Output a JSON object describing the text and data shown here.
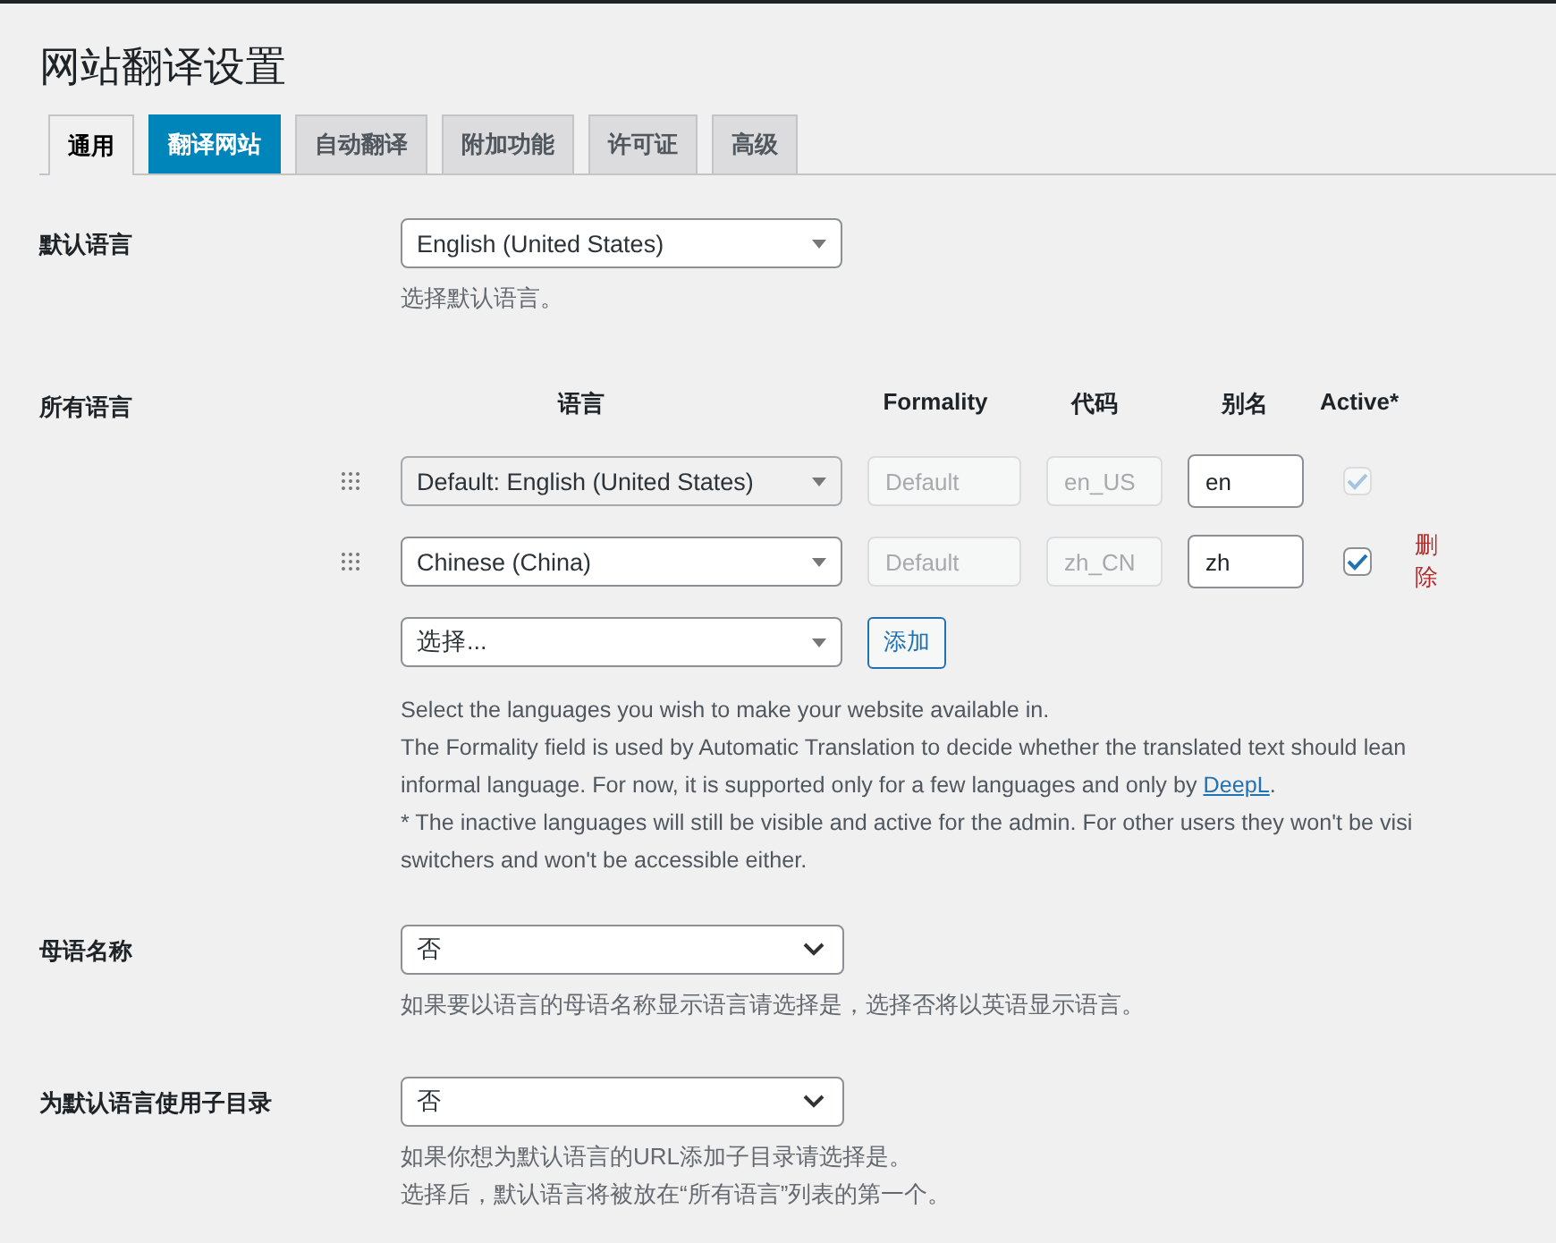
{
  "page_title": "网站翻译设置",
  "tabs": [
    {
      "label": "通用",
      "selected": true,
      "highlighted": false
    },
    {
      "label": "翻译网站",
      "selected": false,
      "highlighted": true
    },
    {
      "label": "自动翻译",
      "selected": false,
      "highlighted": false
    },
    {
      "label": "附加功能",
      "selected": false,
      "highlighted": false
    },
    {
      "label": "许可证",
      "selected": false,
      "highlighted": false
    },
    {
      "label": "高级",
      "selected": false,
      "highlighted": false
    }
  ],
  "default_language": {
    "label": "默认语言",
    "value": "English (United States)",
    "hint": "选择默认语言。"
  },
  "all_languages": {
    "label": "所有语言",
    "columns": [
      "语言",
      "Formality",
      "代码",
      "别名",
      "Active*"
    ],
    "rows": [
      {
        "language": "Default: English (United States)",
        "disabled": true,
        "formality_placeholder": "Default",
        "code": "en_US",
        "slug": "en",
        "active": true,
        "delete": ""
      },
      {
        "language": "Chinese (China)",
        "disabled": false,
        "formality_placeholder": "Default",
        "code": "zh_CN",
        "slug": "zh",
        "active": true,
        "delete": "删除"
      }
    ],
    "add_select": "选择...",
    "add_button": "添加",
    "description": [
      {
        "text": "Select the languages you wish to make your website available in."
      },
      {
        "text": "The Formality field is used by Automatic Translation to decide whether the translated text should lean"
      },
      {
        "text": "informal language. For now, it is supported only for a few languages and only by ",
        "link": "DeepL",
        "after": "."
      },
      {
        "text": "* The inactive languages will still be visible and active for the admin. For other users they won't be visi"
      },
      {
        "text": "switchers and won't be accessible either."
      }
    ]
  },
  "settings": [
    {
      "label": "母语名称",
      "value": "否",
      "hints": [
        "如果要以语言的母语名称显示语言请选择是，选择否将以英语显示语言。"
      ]
    },
    {
      "label": "为默认语言使用子目录",
      "value": "否",
      "hints": [
        "如果你想为默认语言的URL添加子目录请选择是。",
        "选择后，默认语言将被放在“所有语言”列表的第一个。"
      ]
    }
  ]
}
